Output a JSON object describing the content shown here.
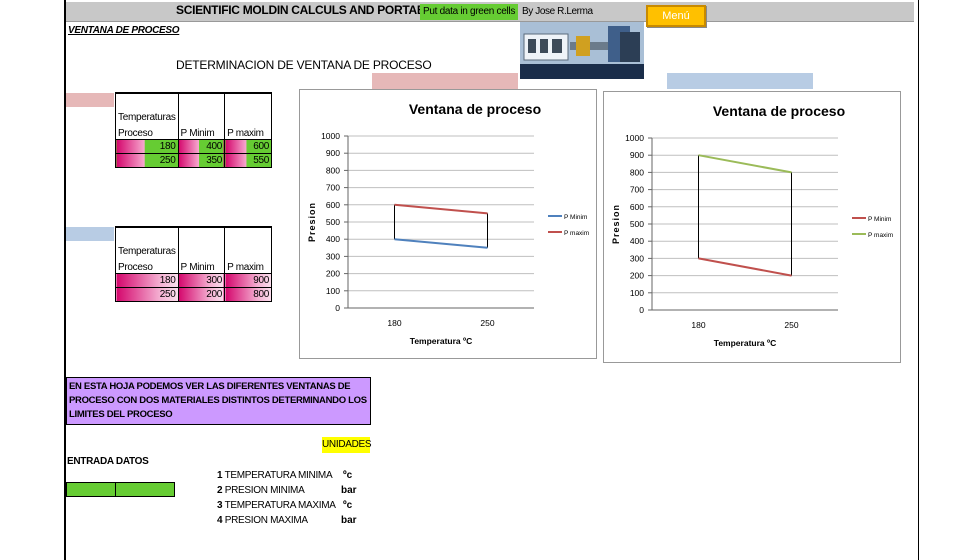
{
  "header": {
    "title": "SCIENTIFIC MOLDIN CALCULS AND PORTABILITY",
    "hint": "Put data in green cells",
    "author": "By Jose R.Lerma",
    "menu_label": "Menú"
  },
  "sheet": {
    "ventana_label": "VENTANA DE PROCESO",
    "heading": "DETERMINACION DE VENTANA DE PROCESO"
  },
  "table1": {
    "col1_line1": "Temperaturas",
    "col1_line2": "Proceso",
    "col2": "P Minim",
    "col3": "P maxim",
    "rows": [
      {
        "temp": "180",
        "pmin": "400",
        "pmax": "600"
      },
      {
        "temp": "250",
        "pmin": "350",
        "pmax": "550"
      }
    ]
  },
  "table2": {
    "col1_line1": "Temperaturas",
    "col1_line2": "Proceso",
    "col2": "P Minim",
    "col3": "P maxim",
    "rows": [
      {
        "temp": "180",
        "pmin": "300",
        "pmax": "900"
      },
      {
        "temp": "250",
        "pmin": "200",
        "pmax": "800"
      }
    ]
  },
  "chart_data": [
    {
      "type": "line",
      "title": "Ventana de proceso",
      "xlabel": "Temperatura ºC",
      "ylabel": "Presion",
      "categories": [
        "180",
        "250"
      ],
      "ylim": [
        0,
        1000
      ],
      "yticks": [
        "0",
        "100",
        "200",
        "300",
        "400",
        "500",
        "600",
        "700",
        "800",
        "900",
        "1000"
      ],
      "grid": true,
      "legend": "right",
      "series": [
        {
          "name": "P Minim",
          "values": [
            400,
            350
          ],
          "color": "#4f81bd"
        },
        {
          "name": "P maxim",
          "values": [
            600,
            550
          ],
          "color": "#c0504d"
        }
      ],
      "connectors": [
        [
          180,
          400,
          600
        ],
        [
          250,
          350,
          550
        ]
      ]
    },
    {
      "type": "line",
      "title": "Ventana de proceso",
      "xlabel": "Temperatura ºC",
      "ylabel": "Presion",
      "categories": [
        "180",
        "250"
      ],
      "ylim": [
        0,
        1000
      ],
      "yticks": [
        "0",
        "100",
        "200",
        "300",
        "400",
        "500",
        "600",
        "700",
        "800",
        "900",
        "1000"
      ],
      "grid": true,
      "legend": "right",
      "series": [
        {
          "name": "P Minim",
          "values": [
            300,
            200
          ],
          "color": "#c0504d"
        },
        {
          "name": "P maxim",
          "values": [
            900,
            800
          ],
          "color": "#9bbb59"
        }
      ],
      "connectors": [
        [
          180,
          300,
          900
        ],
        [
          250,
          200,
          800
        ]
      ]
    }
  ],
  "info": {
    "text": "EN ESTA HOJA PODEMOS VER LAS DIFERENTES VENTANAS DE PROCESO CON DOS MATERIALES DISTINTOS DETERMINANDO LOS LIMITES DEL PROCESO"
  },
  "inputs": {
    "unidades_label": "UNIDADES",
    "entrada_label": "ENTRADA DATOS",
    "params": [
      {
        "num": "1",
        "label": "TEMPERATURA MINIMA",
        "unit": "ºc"
      },
      {
        "num": "2",
        "label": "PRESION MINIMA",
        "unit": "bar"
      },
      {
        "num": "3",
        "label": "TEMPERATURA MAXIMA",
        "unit": "ºc"
      },
      {
        "num": "4",
        "label": "PRESION MAXIMA",
        "unit": "bar"
      }
    ]
  },
  "colors": {
    "green": "#66cc33",
    "menu": "#ffc000",
    "info_bg": "#cc99ff",
    "unidades_bg": "#ffff00"
  }
}
